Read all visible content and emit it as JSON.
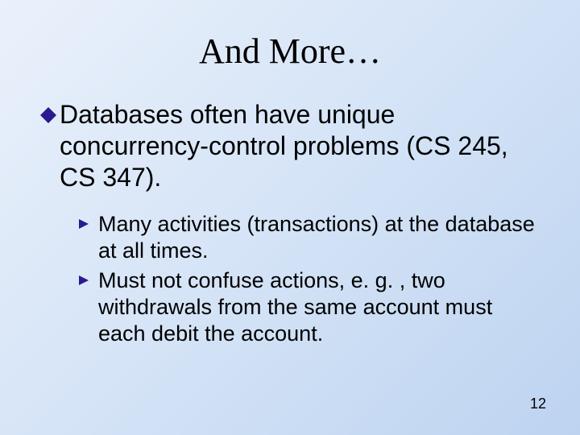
{
  "slide": {
    "title": "And More…",
    "main_bullet": "Databases often have unique concurrency-control problems (CS 245, CS 347).",
    "sub_bullets": [
      "Many activities (transactions) at the database at all times.",
      "Must not confuse actions, e. g. , two withdrawals from the same account must each debit the account."
    ],
    "page_number": "12"
  }
}
